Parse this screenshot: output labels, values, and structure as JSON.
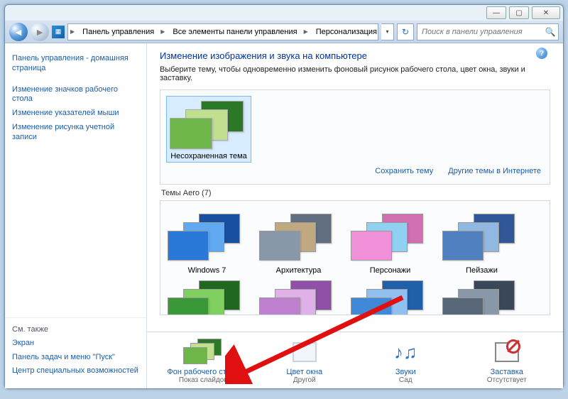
{
  "window_buttons": {
    "min": "—",
    "max": "▢",
    "close": "✕"
  },
  "breadcrumb": {
    "items": [
      "Панель управления",
      "Все элементы панели управления",
      "Персонализация"
    ]
  },
  "search": {
    "placeholder": "Поиск в панели управления"
  },
  "sidebar": {
    "top": [
      "Панель управления - домашняя страница",
      "Изменение значков рабочего стола",
      "Изменение указателей мыши",
      "Изменение рисунка учетной записи"
    ],
    "see_also_head": "См. также",
    "see_also": [
      "Экран",
      "Панель задач и меню \"Пуск\"",
      "Центр специальных возможностей"
    ]
  },
  "main": {
    "title": "Изменение изображения и звука на компьютере",
    "desc": "Выберите тему, чтобы одновременно изменить фоновый рисунок рабочего стола, цвет окна, звуки и заставку.",
    "my_themes_item": "Несохраненная тема",
    "save_theme": "Сохранить тему",
    "more_themes": "Другие темы в Интернете",
    "aero_label": "Темы Aero (7)",
    "aero": [
      "Windows 7",
      "Архитектура",
      "Персонажи",
      "Пейзажи"
    ]
  },
  "bottom": {
    "bg": {
      "label": "Фон рабочего стола",
      "sub": "Показ слайдов"
    },
    "color": {
      "label": "Цвет окна",
      "sub": "Другой"
    },
    "sounds": {
      "label": "Звуки",
      "sub": "Сад"
    },
    "saver": {
      "label": "Заставка",
      "sub": "Отсутствует"
    }
  },
  "colors": {
    "unsaved": [
      "#6fb64a",
      "#c0e090",
      "#2a7828"
    ],
    "win7": [
      "#2a78d8",
      "#60a8f0",
      "#1850a0"
    ],
    "arch": [
      "#8898a8",
      "#c0a880",
      "#607080"
    ],
    "pers": [
      "#f090d8",
      "#90d0f0",
      "#d070b0"
    ],
    "land": [
      "#5080c0",
      "#90b8e0",
      "#305898"
    ],
    "row2a": [
      "#3a9838",
      "#80d060",
      "#206820"
    ],
    "row2b": [
      "#c080d0",
      "#e0b0e8",
      "#9050a8"
    ],
    "row2c": [
      "#4088d8",
      "#90c0f0",
      "#2060a8"
    ],
    "row2d": [
      "#586878",
      "#8898a8",
      "#384858"
    ]
  }
}
